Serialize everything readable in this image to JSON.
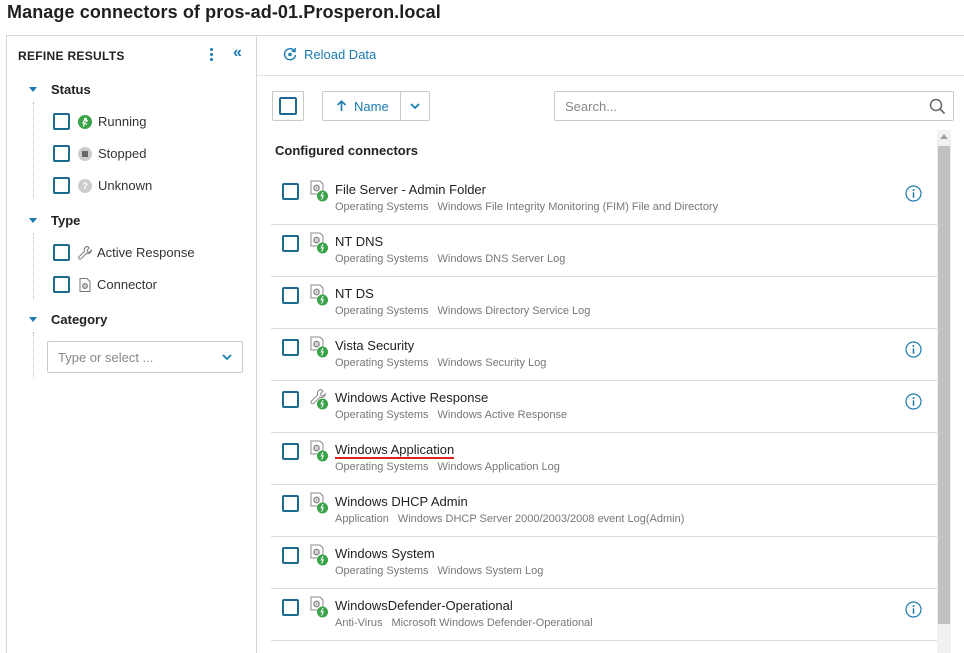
{
  "page": {
    "title": "Manage connectors of pros-ad-01.Prosperon.local"
  },
  "sidebar": {
    "title": "REFINE RESULTS",
    "groups": {
      "status": {
        "label": "Status",
        "items": [
          "Running",
          "Stopped",
          "Unknown"
        ]
      },
      "type": {
        "label": "Type",
        "items": [
          "Active Response",
          "Connector"
        ]
      },
      "category": {
        "label": "Category",
        "placeholder": "Type or select ..."
      }
    }
  },
  "toolbar": {
    "reload_label": "Reload Data",
    "sort_label": "Name",
    "search_placeholder": "Search..."
  },
  "list": {
    "section_title": "Configured connectors",
    "rows": [
      {
        "name": "File Server - Admin Folder",
        "category": "Operating Systems",
        "description": "Windows File Integrity Monitoring (FIM) File and Directory",
        "icon": "connector-running-icon",
        "info": true
      },
      {
        "name": "NT DNS",
        "category": "Operating Systems",
        "description": "Windows DNS Server Log",
        "icon": "connector-running-icon",
        "info": false
      },
      {
        "name": "NT DS",
        "category": "Operating Systems",
        "description": "Windows Directory Service Log",
        "icon": "connector-running-icon",
        "info": false
      },
      {
        "name": "Vista Security",
        "category": "Operating Systems",
        "description": "Windows Security Log",
        "icon": "connector-running-icon",
        "info": true
      },
      {
        "name": "Windows Active Response",
        "category": "Operating Systems",
        "description": "Windows Active Response",
        "icon": "wrench-icon",
        "info": true
      },
      {
        "name": "Windows Application",
        "category": "Operating Systems",
        "description": "Windows Application Log",
        "icon": "connector-running-icon",
        "info": false
      },
      {
        "name": "Windows DHCP Admin",
        "category": "Application",
        "description": "Windows DHCP Server 2000/2003/2008 event Log(Admin)",
        "icon": "connector-running-icon",
        "info": false
      },
      {
        "name": "Windows System",
        "category": "Operating Systems",
        "description": "Windows System Log",
        "icon": "connector-running-icon",
        "info": false
      },
      {
        "name": "WindowsDefender-Operational",
        "category": "Anti-Virus",
        "description": "Microsoft Windows Defender-Operational",
        "icon": "connector-running-icon",
        "info": true
      }
    ]
  },
  "colors": {
    "accent": "#1a7bb0",
    "running": "#3aa34a",
    "annotation": "#dd2222"
  }
}
